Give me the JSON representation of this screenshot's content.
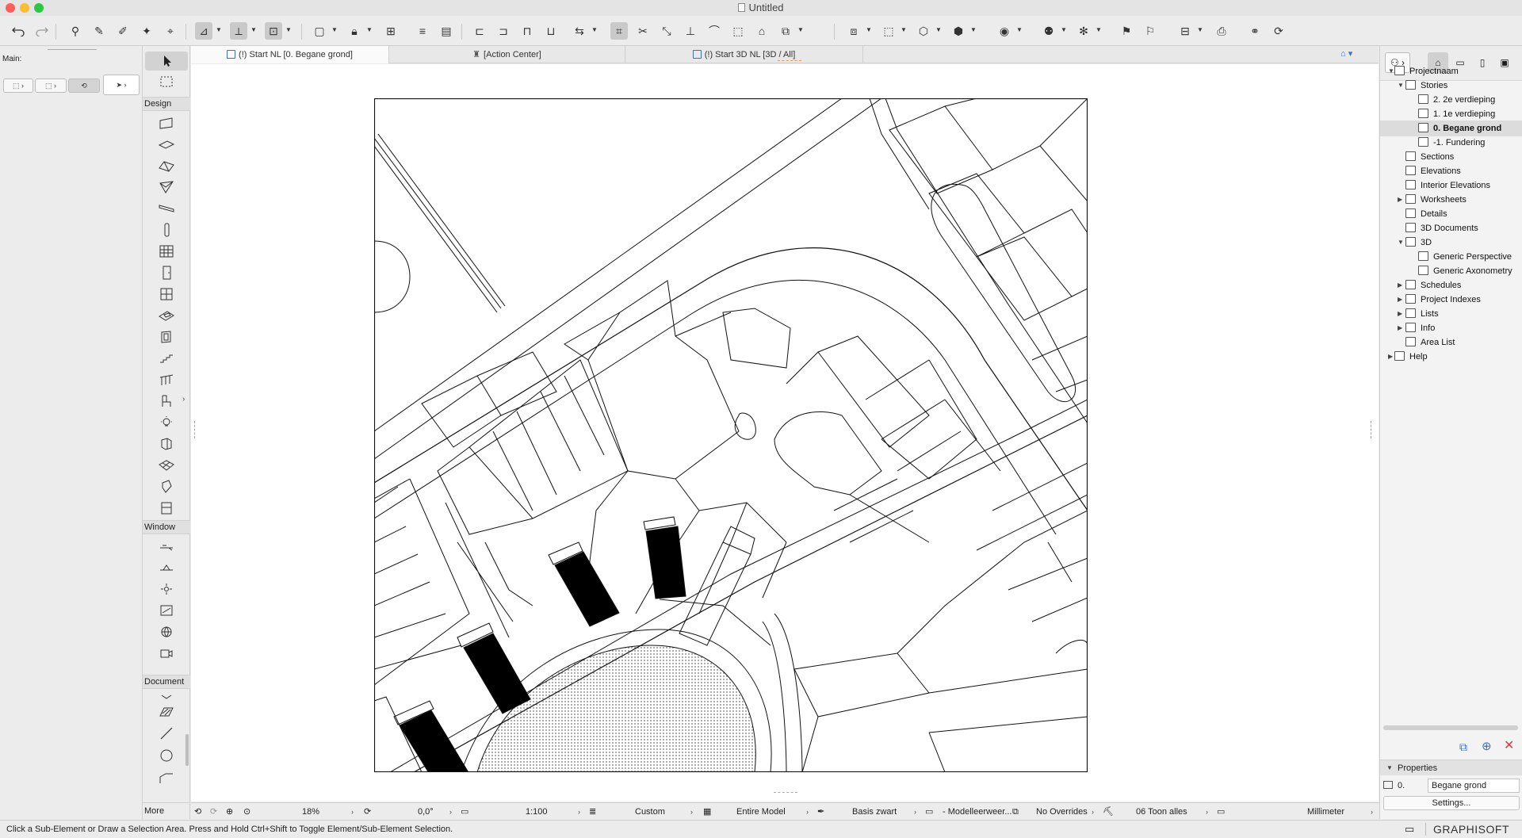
{
  "window": {
    "title": "Untitled"
  },
  "left_panel": {
    "main_label": "Main:"
  },
  "toolbox": {
    "sections": {
      "design": "Design",
      "window": "Window",
      "document": "Document",
      "more": "More"
    }
  },
  "tabs": [
    {
      "label": "(!) Start NL [0. Begane grond]"
    },
    {
      "label": "[Action Center]"
    },
    {
      "label": "(!) Start 3D NL [3D / All]"
    }
  ],
  "navigator": {
    "items": [
      "Projectnaam",
      "Stories",
      "2. 2e verdieping",
      "1. 1e verdieping",
      "0. Begane grond",
      "-1. Fundering",
      "Sections",
      "Elevations",
      "Interior Elevations",
      "Worksheets",
      "Details",
      "3D Documents",
      "3D",
      "Generic Perspective",
      "Generic Axonometry",
      "Schedules",
      "Project Indexes",
      "Lists",
      "Info",
      "Area List",
      "Help"
    ],
    "properties_label": "Properties",
    "story_number": "0.",
    "story_value": "Begane grond",
    "settings_label": "Settings..."
  },
  "viewbar": {
    "zoom": "18%",
    "angle": "0,0°",
    "scale": "1:100",
    "layer_combo": "Custom",
    "model_view": "Entire Model",
    "pen_set": "Basis zwart",
    "mvo": "- Modelleerweer...",
    "overrides": "No Overrides",
    "renovation": "06 Toon alles",
    "dimensions": "Millimeter"
  },
  "status": {
    "message": "Click a Sub-Element or Draw a Selection Area. Press and Hold Ctrl+Shift to Toggle Element/Sub-Element Selection.",
    "brand": "GRAPHISOFT ID"
  },
  "colors": {
    "traffic_close": "#ff5f57",
    "traffic_min": "#febc2e",
    "traffic_max": "#28c840",
    "accent": "#3a6fc4",
    "delete": "#d33c3c"
  },
  "icons": [
    "undo-icon",
    "redo-icon",
    "pointer-icon",
    "selection-icon",
    "arrow-icon",
    "marquee-icon",
    "wall-icon",
    "column-icon",
    "beam-icon",
    "slab-icon",
    "roof-icon",
    "shell-icon",
    "door-icon",
    "window-icon",
    "stair-icon",
    "railing-icon",
    "object-icon",
    "lamp-icon",
    "zone-icon",
    "mesh-icon",
    "curtainwall-icon",
    "morph-icon",
    "dimension-icon",
    "label-icon",
    "line-icon",
    "circle-icon",
    "polyline-icon",
    "camera-icon",
    "help-icon"
  ]
}
